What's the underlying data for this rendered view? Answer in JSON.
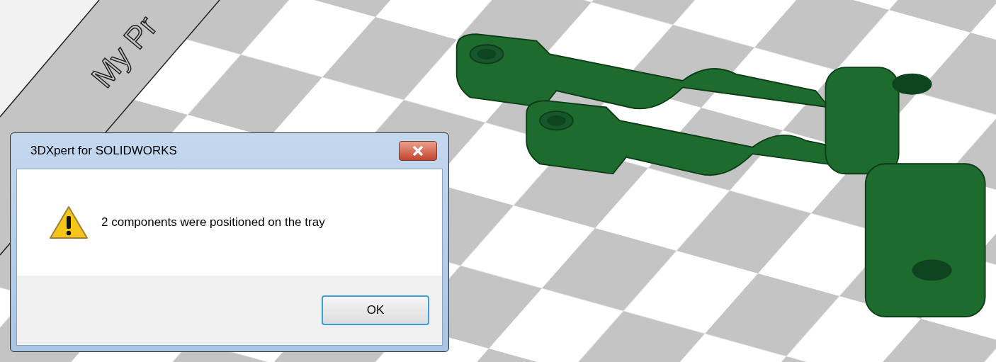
{
  "viewport": {
    "tray_label": "My Pr"
  },
  "dialog": {
    "title": "3DXpert for SOLIDWORKS",
    "message": "2 components were positioned on the tray",
    "buttons": [
      "OK"
    ]
  }
}
